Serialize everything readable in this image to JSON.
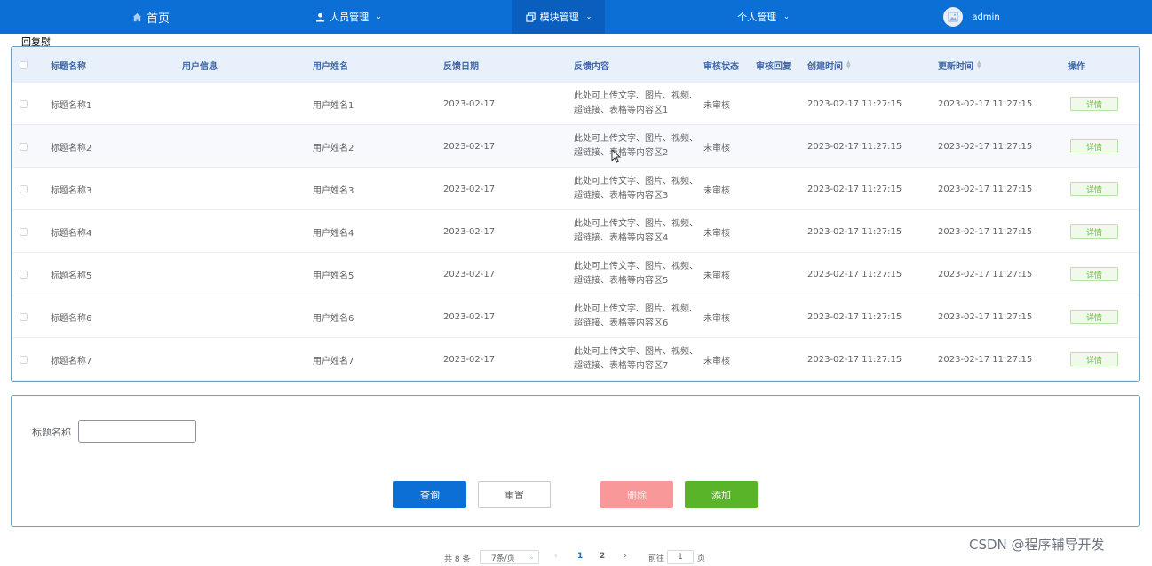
{
  "nav": {
    "home": "首页",
    "people": "人员管理",
    "modules": "模块管理",
    "personal": "个人管理",
    "user": "admin"
  },
  "window_label": "回复慰",
  "table": {
    "headers": {
      "title": "标题名称",
      "user_info": "用户信息",
      "user_name": "用户姓名",
      "date": "反馈日期",
      "content": "反馈内容",
      "status": "审核状态",
      "reply": "审核回复",
      "created": "创建时间",
      "updated": "更新时间",
      "action": "操作"
    },
    "rows": [
      {
        "title": "标题名称1",
        "user_name": "用户姓名1",
        "date": "2023-02-17",
        "content": "此处可上传文字、图片、视频、超链接、表格等内容区1",
        "status": "未审核",
        "created": "2023-02-17 11:27:15",
        "updated": "2023-02-17 11:27:15",
        "action": "详情"
      },
      {
        "title": "标题名称2",
        "user_name": "用户姓名2",
        "date": "2023-02-17",
        "content": "此处可上传文字、图片、视频、超链接、表格等内容区2",
        "status": "未审核",
        "created": "2023-02-17 11:27:15",
        "updated": "2023-02-17 11:27:15",
        "action": "详情"
      },
      {
        "title": "标题名称3",
        "user_name": "用户姓名3",
        "date": "2023-02-17",
        "content": "此处可上传文字、图片、视频、超链接、表格等内容区3",
        "status": "未审核",
        "created": "2023-02-17 11:27:15",
        "updated": "2023-02-17 11:27:15",
        "action": "详情"
      },
      {
        "title": "标题名称4",
        "user_name": "用户姓名4",
        "date": "2023-02-17",
        "content": "此处可上传文字、图片、视频、超链接、表格等内容区4",
        "status": "未审核",
        "created": "2023-02-17 11:27:15",
        "updated": "2023-02-17 11:27:15",
        "action": "详情"
      },
      {
        "title": "标题名称5",
        "user_name": "用户姓名5",
        "date": "2023-02-17",
        "content": "此处可上传文字、图片、视频、超链接、表格等内容区5",
        "status": "未审核",
        "created": "2023-02-17 11:27:15",
        "updated": "2023-02-17 11:27:15",
        "action": "详情"
      },
      {
        "title": "标题名称6",
        "user_name": "用户姓名6",
        "date": "2023-02-17",
        "content": "此处可上传文字、图片、视频、超链接、表格等内容区6",
        "status": "未审核",
        "created": "2023-02-17 11:27:15",
        "updated": "2023-02-17 11:27:15",
        "action": "详情"
      },
      {
        "title": "标题名称7",
        "user_name": "用户姓名7",
        "date": "2023-02-17",
        "content": "此处可上传文字、图片、视频、超链接、表格等内容区7",
        "status": "未审核",
        "created": "2023-02-17 11:27:15",
        "updated": "2023-02-17 11:27:15",
        "action": "详情"
      }
    ]
  },
  "search": {
    "label": "标题名称",
    "value": "",
    "query": "查询",
    "reset": "重置",
    "delete": "删除",
    "add": "添加"
  },
  "pager": {
    "total": "共 8 条",
    "page_size": "7条/页",
    "pages": [
      "1",
      "2"
    ],
    "goto": "前往",
    "current": "1",
    "unit": "页"
  },
  "watermark": "CSDN @程序辅导开发"
}
